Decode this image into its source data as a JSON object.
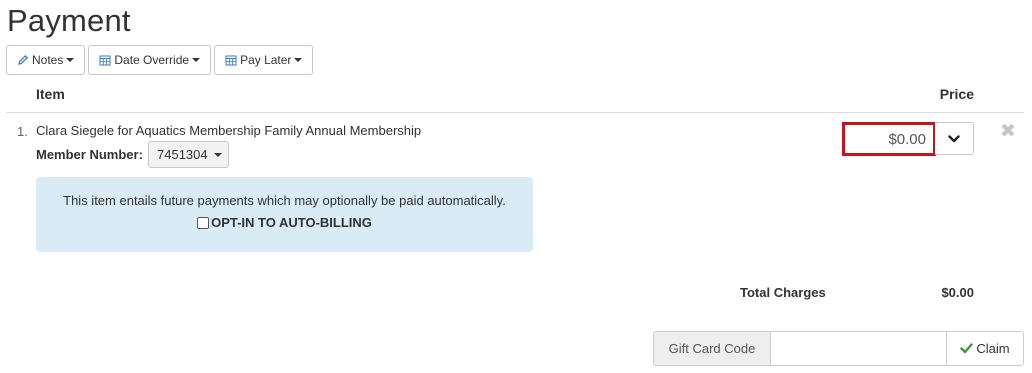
{
  "page": {
    "title": "Payment"
  },
  "toolbar": {
    "notes_label": "Notes",
    "date_override_label": "Date Override",
    "pay_later_label": "Pay Later"
  },
  "table": {
    "col_item": "Item",
    "col_price": "Price"
  },
  "line_item": {
    "number": "1.",
    "name": "Clara Siegele for Aquatics Membership Family Annual Membership",
    "member_label": "Member Number:",
    "member_number": "7451304",
    "info_text": "This item entails future payments which may optionally be paid automatically.",
    "opt_in_label": "OPT-IN TO AUTO-BILLING",
    "opt_in_checked": false,
    "price": "$0.00",
    "remove_glyph": "✖"
  },
  "totals": {
    "label": "Total Charges",
    "value": "$0.00"
  },
  "gift_card": {
    "addon_label": "Gift Card Code",
    "input_value": "",
    "claim_label": "Claim"
  },
  "colors": {
    "accent_red": "#c2151f",
    "info_bg": "#d9ecf6",
    "claim_check": "#3c9a3c"
  },
  "icons": {
    "notes": "pencil-icon",
    "date_override": "calendar-icon",
    "pay_later": "calendar-icon",
    "price_toggle": "chevron-down-icon",
    "remove": "close-icon",
    "claim": "check-icon"
  }
}
